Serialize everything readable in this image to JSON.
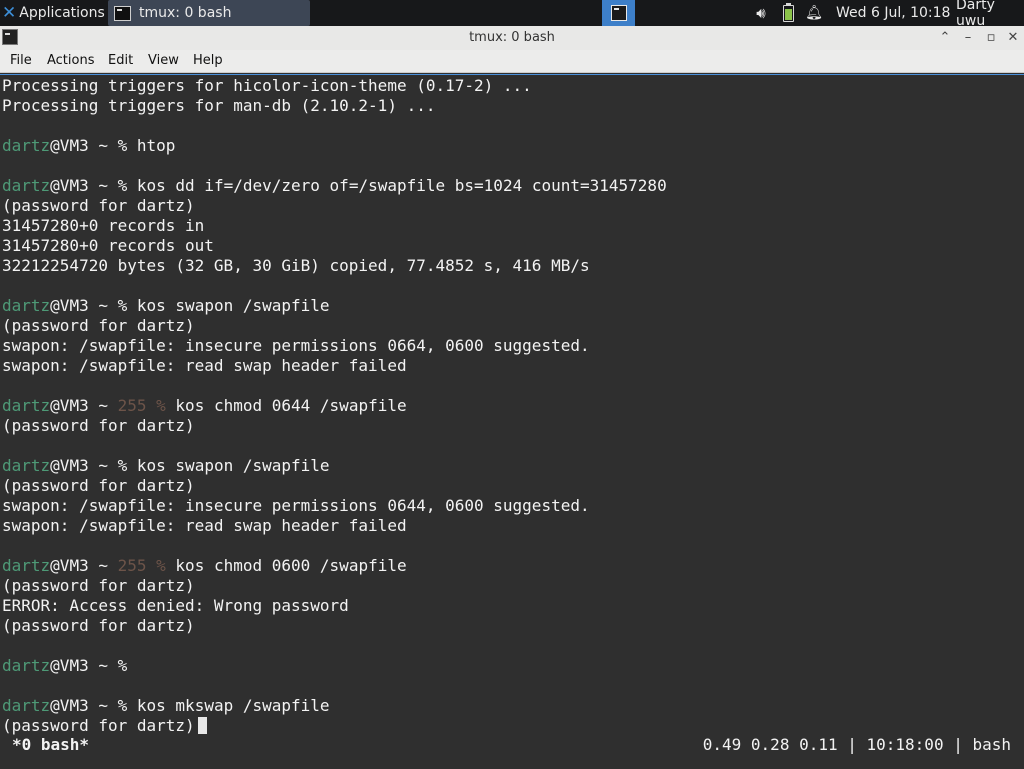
{
  "panel": {
    "applications_label": "Applications",
    "task_label": "tmux: 0 bash",
    "clock": "Wed  6 Jul, 10:18",
    "user": "Darty uwu"
  },
  "window": {
    "title": "tmux: 0 bash",
    "up_glyph": "⌃",
    "min_glyph": "–",
    "max_glyph": "▫",
    "close_glyph": "✕"
  },
  "menu": {
    "file": "File",
    "actions": "Actions",
    "edit": "Edit",
    "view": "View",
    "help": "Help"
  },
  "prompt": {
    "user": "dartz",
    "host": "@VM3 ~ ",
    "ok_symbol": "%",
    "err_code": "255 %"
  },
  "terminal": {
    "l0": "Processing triggers for hicolor-icon-theme (0.17-2) ...",
    "l1": "Processing triggers for man-db (2.10.2-1) ...",
    "c3": "htop",
    "c5": "kos dd if=/dev/zero of=/swapfile bs=1024 count=31457280",
    "l6": "(password for dartz)",
    "l7": "31457280+0 records in",
    "l8": "31457280+0 records out",
    "l9": "32212254720 bytes (32 GB, 30 GiB) copied, 77.4852 s, 416 MB/s",
    "c11": "kos swapon /swapfile",
    "l12": "(password for dartz)",
    "l13": "swapon: /swapfile: insecure permissions 0664, 0600 suggested.",
    "l14": "swapon: /swapfile: read swap header failed",
    "c16": "kos chmod 0644 /swapfile",
    "l17": "(password for dartz)",
    "c19": "kos swapon /swapfile",
    "l20": "(password for dartz)",
    "l21": "swapon: /swapfile: insecure permissions 0644, 0600 suggested.",
    "l22": "swapon: /swapfile: read swap header failed",
    "c24": "kos chmod 0600 /swapfile",
    "l25": "(password for dartz)",
    "l26": "ERROR: Access denied: Wrong password",
    "l27": "(password for dartz)",
    "c31": "kos mkswap /swapfile",
    "l32": "(password for dartz)"
  },
  "tmux": {
    "window_label": "*0 bash*",
    "status": "0.49 0.28 0.11 | 10:18:00 | bash"
  },
  "icons": {
    "panel": [
      "xfce-logo-icon",
      "terminal-icon",
      "workspace-icon",
      "volume-icon",
      "battery-icon",
      "bell-icon"
    ],
    "titlebar": [
      "terminal-icon",
      "chevron-up-icon",
      "minimize-icon",
      "maximize-icon",
      "close-icon"
    ]
  },
  "colors": {
    "prompt_user": "#4e9a77",
    "error_code": "#6d5449",
    "terminal_bg": "#2f2f2f",
    "workspace_active": "#3d7fc9",
    "terminal_accent": "#4a90d9"
  }
}
